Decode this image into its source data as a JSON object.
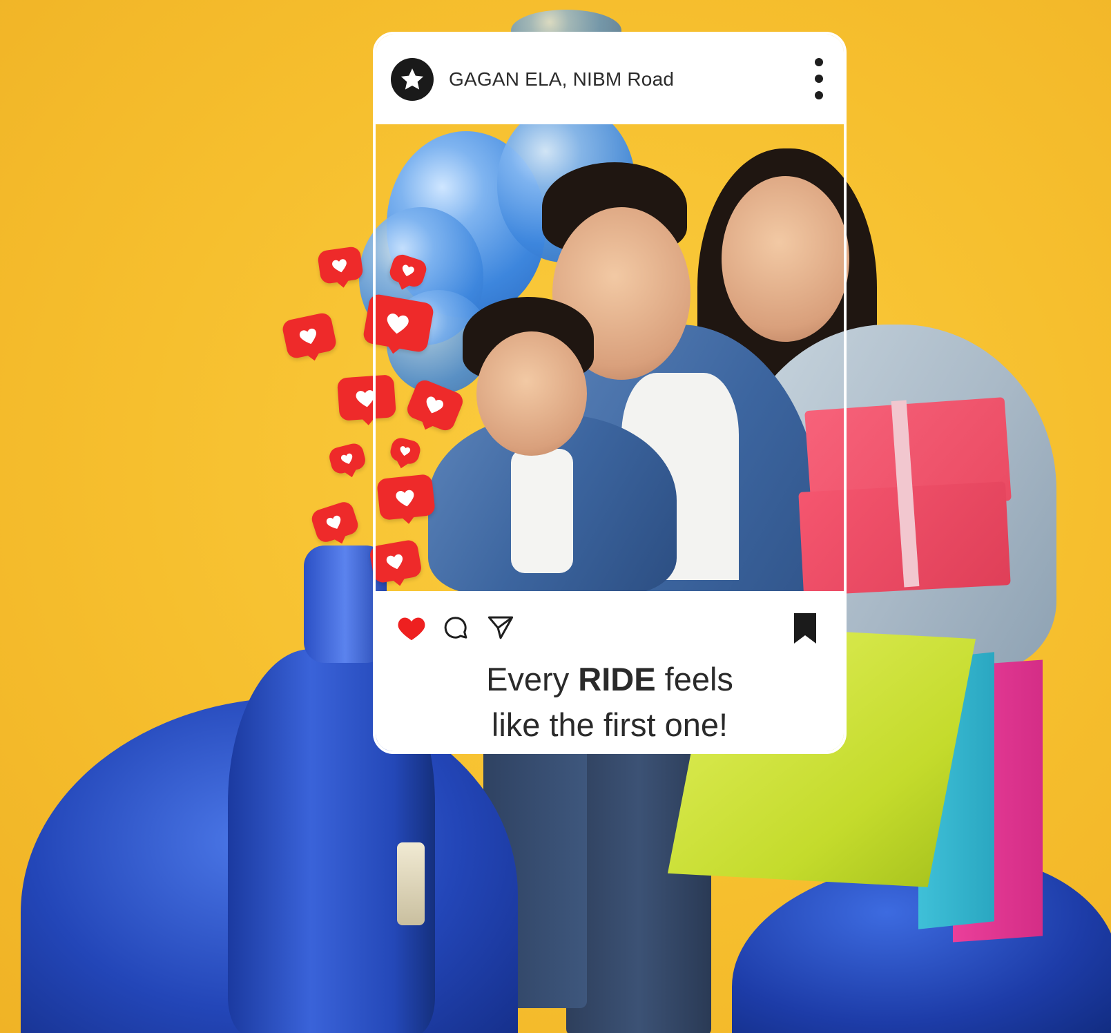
{
  "post": {
    "account_name": "GAGAN ELA, NIBM Road",
    "avatar_icon": "star-icon",
    "menu_icon": "more-vertical-icon",
    "actions": {
      "like_icon": "heart-filled-icon",
      "comment_icon": "comment-icon",
      "share_icon": "send-icon",
      "save_icon": "bookmark-filled-icon"
    },
    "caption": {
      "part1": "Every ",
      "emphasis": "RIDE",
      "part2": " feels",
      "line2": "like the first one!"
    }
  },
  "decor": {
    "reaction_icon": "heart-bubble-icon",
    "reaction_color": "#ee2a2a",
    "background_color": "#f6c030"
  }
}
